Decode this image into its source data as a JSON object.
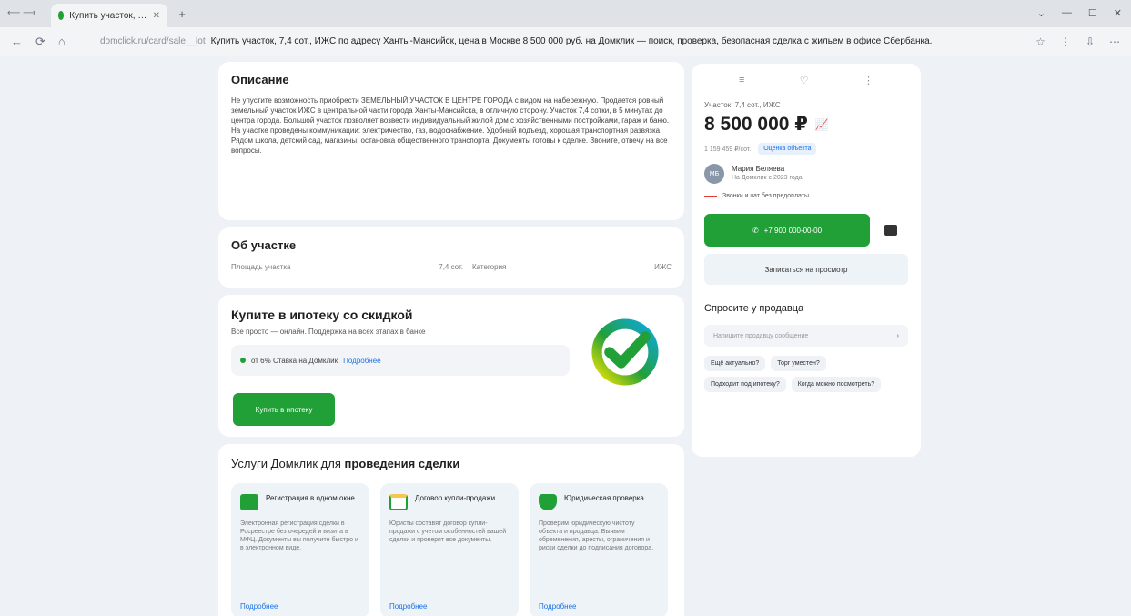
{
  "browser": {
    "tab_title": "Купить участок, 7,4 сот., ИЖС",
    "nav_mini": "⟵ ⟶",
    "new_tab": "+",
    "window_controls": [
      "⌄",
      "—",
      "☐",
      "✕"
    ],
    "url_host": "domclick.ru/card/sale__lot",
    "url_path": "Купить участок, 7,4 сот., ИЖС по адресу Ханты-Мансийск, цена в Москве 8 500 000 руб. на Домклик — поиск, проверка, безопасная сделка с жильем в офисе Сбербанка.",
    "nav_buttons": [
      "←",
      "⟳",
      "⌂"
    ],
    "addr_icons": [
      "☆",
      "⋮",
      "⇩",
      "⋯"
    ]
  },
  "description": {
    "title": "Описание",
    "text": "Не упустите возможность приобрести ЗЕМЕЛЬНЫЙ УЧАСТОК В ЦЕНТРЕ ГОРОДА с видом на набережную. Продается ровный земельный участок ИЖС в центральной части города Ханты-Мансийска, в отличную сторону. Участок 7,4 сотки, в 5 минутах до центра города. Большой участок позволяет возвести индивидуальный жилой дом с хозяйственными постройками, гараж и баню. На участке проведены коммуникации: электричество, газ, водоснабжение. Удобный подъезд, хорошая транспортная развязка. Рядом школа, детский сад, магазины, остановка общественного транспорта. Документы готовы к сделке. Звоните, отвечу на все вопросы."
  },
  "ok_section": {
    "title": "Об участке",
    "area_label": "Площадь участка",
    "area_value": "7,4 сот.",
    "category_label": "Категория",
    "category_value": "ИЖС"
  },
  "mortgage": {
    "title": "Купите в ипотеку со скидкой",
    "subtitle": "Все просто — онлайн. Поддержка на всех этапах в банке",
    "rate_text": "от 6% Ставка на Домклик",
    "rate_link": "Подробнее",
    "button": "Купить в ипотеку"
  },
  "services": {
    "title_prefix": "Услуги Домклик для",
    "title_bold": "проведения сделки",
    "items": [
      {
        "title": "Регистрация в одном окне",
        "desc": "Электронная регистрация сделки в Росреестре без очередей и визита в МФЦ. Документы вы получите быстро и в электронном виде.",
        "more": "Подробнее",
        "color": "#21a038"
      },
      {
        "title": "Договор купли-продажи",
        "desc": "Юристы составят договор купли-продажи с учетом особенностей вашей сделки и проверят все документы.",
        "more": "Подробнее",
        "color": "#f2c94c"
      },
      {
        "title": "Юридическая проверка",
        "desc": "Проверим юридическую чистоту объекта и продавца. Выявим обременения, аресты, ограничения и риски сделки до подписания договора.",
        "more": "Подробнее",
        "color": "#21a038"
      }
    ]
  },
  "sidebar": {
    "top_icons": [
      "≡",
      "♡",
      "⋮"
    ],
    "kind": "Участок, 7,4 сот., ИЖС",
    "price": "8 500 000 ₽",
    "price_chart_icon": "📈",
    "badge_plain": "1 159 459 ₽/сот.",
    "badge_link": "Оценка объекта",
    "seller_initials": "МБ",
    "seller_name": "Мария Беляева",
    "seller_sub": "На Домклик с 2023 года",
    "warning": "Звонки и чат без предоплаты",
    "phone_btn": "+7 900 000-00-00",
    "phone_icon": "✆",
    "track_btn": "Записаться на просмотр",
    "ask_title": "Спросите у продавца",
    "ask_placeholder": "Напишите продавцу сообщение",
    "chips": [
      "Ещё актуально?",
      "Торг уместен?",
      "Подходит под ипотеку?",
      "Когда можно посмотреть?"
    ]
  }
}
